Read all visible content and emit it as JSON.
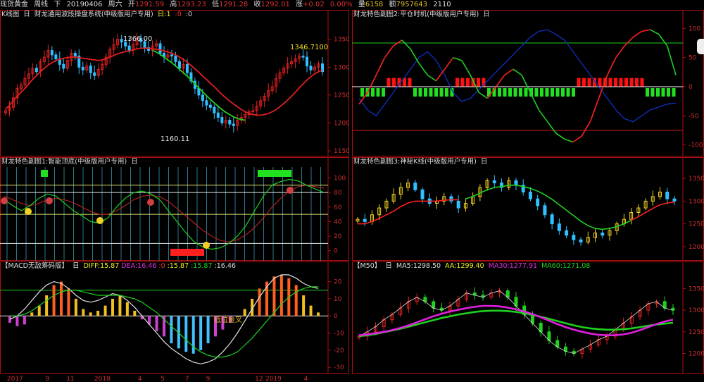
{
  "header": {
    "instrument": "现货黄金",
    "period": "周线",
    "direction": "下",
    "date": "20190406",
    "weekday": "周六",
    "open_label": "开",
    "open": "1291.59",
    "high_label": "高",
    "high": "1293.23",
    "low_label": "低",
    "low": "1291.28",
    "close_label": "收",
    "close": "1292.01",
    "change_label": "涨",
    "change": "+0.02",
    "change_pct": "0.00%",
    "volume_label": "量",
    "volume": "6158",
    "amount_label": "额",
    "amount": "7957643",
    "extra": "2110"
  },
  "panels": {
    "kline": {
      "title": "K线图",
      "box": "日",
      "subtitle": "财龙通用波段操盘系统(中级版用户专用)",
      "param1": "日:1",
      "param2": ":0",
      "param3": ":0",
      "ann_high": "1366.00",
      "ann_low": "1160.11",
      "ann_last": "1346.7100"
    },
    "sub2": {
      "title": "财龙特色副图2:平仓时机(中级版用户专用)",
      "box": "日"
    },
    "sub1": {
      "title": "财龙特色副图1:智能顶底(中级版用户专用)",
      "box": "日"
    },
    "sub3": {
      "title": "财龙特色副图3:神秘K线(中级版用户专用)",
      "box": "日"
    },
    "macd": {
      "title": "【MACD无敌筹码版】",
      "box": "日",
      "diff": "DIFF:15.87",
      "dea": "DEA:16.46",
      "v1": ":0",
      "v2": ":15.87",
      "v3": ":15.87",
      "v4": ":16.46",
      "ann": "低位金叉"
    },
    "ma": {
      "title": "【M50】",
      "box": "日",
      "ma5": "MA5:1298.50",
      "aa": "AA:1299.40",
      "ma30": "MA30:1277.91",
      "ma60": "MA60:1271.08"
    }
  },
  "x_axis_labels": [
    {
      "label": "2017",
      "at": 0.02
    },
    {
      "label": "9",
      "at": 0.13
    },
    {
      "label": "11",
      "at": 0.19
    },
    {
      "label": "2018",
      "at": 0.27
    },
    {
      "label": "4",
      "at": 0.395
    },
    {
      "label": "5",
      "at": 0.46
    },
    {
      "label": "7",
      "at": 0.53
    },
    {
      "label": "9",
      "at": 0.59
    },
    {
      "label": "12",
      "at": 0.73
    },
    {
      "label": "2019",
      "at": 0.76
    },
    {
      "label": "4",
      "at": 0.87
    }
  ],
  "chart_data": [
    {
      "type": "candlestick",
      "name": "K线图",
      "y_ticks": [
        1150,
        1200,
        1250,
        1300,
        1350
      ],
      "ylim": [
        1145,
        1385
      ],
      "close": [
        1222,
        1228,
        1245,
        1262,
        1268,
        1280,
        1288,
        1298,
        1292,
        1310,
        1318,
        1330,
        1322,
        1315,
        1305,
        1298,
        1312,
        1325,
        1320,
        1300,
        1295,
        1302,
        1290,
        1285,
        1296,
        1305,
        1318,
        1332,
        1340,
        1350,
        1345,
        1338,
        1330,
        1340,
        1352,
        1346,
        1335,
        1330,
        1338,
        1342,
        1325,
        1318,
        1322,
        1320,
        1310,
        1298,
        1305,
        1290,
        1275,
        1262,
        1250,
        1240,
        1232,
        1228,
        1218,
        1210,
        1200,
        1205,
        1198,
        1195,
        1205,
        1210,
        1215,
        1220,
        1222,
        1230,
        1240,
        1248,
        1258,
        1265,
        1280,
        1290,
        1298,
        1306,
        1310,
        1315,
        1320,
        1318,
        1302,
        1295,
        1300,
        1306,
        1292
      ],
      "ma_red": [
        1225,
        1232,
        1240,
        1248,
        1255,
        1262,
        1270,
        1278,
        1285,
        1292,
        1298,
        1304,
        1308,
        1312,
        1314,
        1316,
        1317,
        1318,
        1318,
        1317,
        1316,
        1315,
        1314,
        1313,
        1312,
        1313,
        1315,
        1318,
        1321,
        1324,
        1326,
        1328,
        1329,
        1331,
        1333,
        1334,
        1334,
        1334,
        1333,
        1332,
        1331,
        1329,
        1327,
        1325,
        1322,
        1318,
        1314,
        1309,
        1303,
        1297,
        1291,
        1284,
        1278,
        1271,
        1265,
        1258,
        1251,
        1245,
        1239,
        1234,
        1229,
        1224,
        1220,
        1217,
        1215,
        1214,
        1214,
        1215,
        1217,
        1220,
        1224,
        1229,
        1235,
        1241,
        1248,
        1255,
        1263,
        1270,
        1277,
        1283,
        1288,
        1292,
        1295
      ],
      "ma_green": [
        null,
        null,
        null,
        null,
        null,
        null,
        null,
        null,
        null,
        null,
        null,
        null,
        null,
        null,
        null,
        null,
        null,
        null,
        null,
        null,
        null,
        null,
        null,
        null,
        null,
        null,
        null,
        null,
        null,
        null,
        null,
        null,
        null,
        null,
        null,
        null,
        null,
        null,
        1330,
        1327,
        1323,
        1318,
        1313,
        1308,
        1302,
        1296,
        1290,
        1284,
        1277,
        1270,
        1263,
        1256,
        1249,
        1242,
        1236,
        1230,
        1224,
        1219,
        1215,
        1211,
        1208,
        1206,
        1205,
        null,
        null,
        null,
        null,
        null,
        null,
        null,
        null,
        null,
        null,
        null,
        null,
        null,
        null,
        null,
        null,
        null,
        null,
        null,
        null
      ]
    },
    {
      "type": "line",
      "name": "财龙特色副图2:平仓时机",
      "y_ticks": [
        -100,
        -50,
        0,
        50,
        100
      ],
      "ylim": [
        -115,
        115
      ],
      "series": [
        {
          "name": "up",
          "values": [
            -30,
            -10,
            20,
            50,
            70,
            80,
            65,
            40,
            20,
            10,
            30,
            50,
            45,
            20,
            -10,
            -20,
            0,
            20,
            30,
            20,
            -10,
            -40,
            -60,
            -80,
            -90,
            -95,
            -85,
            -60,
            -20,
            20,
            50,
            70,
            85,
            95,
            98,
            90,
            70,
            20
          ]
        },
        {
          "name": "down",
          "values": [
            -20,
            -40,
            -50,
            -30,
            -10,
            10,
            30,
            50,
            60,
            45,
            20,
            -10,
            -25,
            -20,
            -5,
            10,
            25,
            40,
            55,
            70,
            85,
            95,
            98,
            90,
            80,
            60,
            40,
            20,
            0,
            -20,
            -40,
            -55,
            -60,
            -50,
            -40,
            -35,
            -30,
            -28
          ]
        }
      ],
      "levels": [
        75,
        0,
        -75
      ]
    },
    {
      "type": "line",
      "name": "财龙特色副图1:智能顶底",
      "y_ticks": [
        0,
        20,
        40,
        60,
        80,
        100
      ],
      "ylim": [
        -10,
        115
      ],
      "series": [
        {
          "name": "fast",
          "values": [
            70,
            62,
            55,
            62,
            72,
            78,
            75,
            65,
            55,
            48,
            40,
            38,
            45,
            60,
            72,
            80,
            82,
            78,
            70,
            55,
            40,
            25,
            12,
            5,
            2,
            4,
            10,
            20,
            35,
            55,
            75,
            90,
            95,
            98,
            96,
            90,
            85,
            80
          ]
        },
        {
          "name": "slow",
          "values": [
            75,
            70,
            65,
            62,
            65,
            70,
            72,
            70,
            66,
            60,
            54,
            50,
            50,
            55,
            62,
            70,
            75,
            76,
            74,
            68,
            58,
            48,
            38,
            28,
            20,
            14,
            12,
            15,
            22,
            32,
            45,
            60,
            72,
            82,
            88,
            90,
            88,
            86
          ]
        }
      ],
      "levels": [
        90,
        80,
        50,
        10
      ]
    },
    {
      "type": "candlestick",
      "name": "财龙特色副图3:神秘K线",
      "y_ticks": [
        1200,
        1250,
        1300,
        1350
      ],
      "ylim": [
        1175,
        1375
      ],
      "close": [
        1260,
        1255,
        1270,
        1285,
        1300,
        1315,
        1330,
        1340,
        1325,
        1305,
        1295,
        1300,
        1310,
        1300,
        1285,
        1295,
        1310,
        1330,
        1345,
        1340,
        1330,
        1345,
        1335,
        1320,
        1305,
        1290,
        1270,
        1250,
        1235,
        1225,
        1215,
        1210,
        1220,
        1230,
        1225,
        1235,
        1250,
        1260,
        1275,
        1285,
        1300,
        1310,
        1320,
        1305,
        1300
      ],
      "line": [
        1250,
        1250,
        1255,
        1262,
        1270,
        1278,
        1288,
        1296,
        1300,
        1300,
        1300,
        1300,
        1302,
        1303,
        1303,
        1305,
        1310,
        1318,
        1325,
        1330,
        1332,
        1335,
        1335,
        1332,
        1328,
        1322,
        1314,
        1304,
        1292,
        1280,
        1268,
        1256,
        1246,
        1240,
        1238,
        1240,
        1244,
        1250,
        1258,
        1266,
        1275,
        1284,
        1292,
        1296,
        1298
      ]
    },
    {
      "type": "bar",
      "name": "MACD无敌筹码版",
      "y_ticks": [
        -30,
        -20,
        -10,
        0,
        10,
        20
      ],
      "ylim": [
        -32,
        26
      ],
      "values": [
        -4,
        -6,
        -5,
        2,
        6,
        12,
        18,
        20,
        16,
        10,
        4,
        2,
        3,
        6,
        10,
        12,
        8,
        3,
        -2,
        -5,
        -9,
        -12,
        -16,
        -19,
        -21,
        -22,
        -20,
        -16,
        -12,
        -8,
        -4,
        0,
        4,
        10,
        16,
        20,
        23,
        24,
        22,
        18,
        12,
        6,
        2
      ],
      "series": [
        {
          "name": "DIFF",
          "values": [
            -2,
            0,
            4,
            9,
            14,
            18,
            20,
            19,
            16,
            12,
            9,
            8,
            9,
            11,
            13,
            12,
            9,
            5,
            0,
            -5,
            -10,
            -15,
            -19,
            -22,
            -25,
            -27,
            -28,
            -27,
            -25,
            -21,
            -16,
            -10,
            -3,
            4,
            11,
            17,
            22,
            24,
            24,
            22,
            19,
            17,
            16
          ]
        },
        {
          "name": "DEA",
          "values": [
            0,
            0,
            1,
            3,
            6,
            9,
            12,
            14,
            15,
            15,
            14,
            13,
            12,
            12,
            12,
            12,
            11,
            10,
            8,
            5,
            2,
            -2,
            -6,
            -10,
            -14,
            -18,
            -21,
            -23,
            -24,
            -24,
            -23,
            -21,
            -17,
            -13,
            -8,
            -3,
            2,
            7,
            11,
            14,
            16,
            17,
            17
          ]
        }
      ]
    },
    {
      "type": "candlestick",
      "name": "M50",
      "y_ticks": [
        1200,
        1250,
        1300,
        1350
      ],
      "ylim": [
        1160,
        1390
      ],
      "close": [
        1240,
        1250,
        1262,
        1278,
        1290,
        1305,
        1320,
        1330,
        1320,
        1305,
        1300,
        1310,
        1325,
        1340,
        1335,
        1330,
        1340,
        1345,
        1330,
        1310,
        1290,
        1270,
        1250,
        1230,
        1215,
        1205,
        1200,
        1210,
        1220,
        1232,
        1240,
        1255,
        1270,
        1285,
        1300,
        1315,
        1320,
        1305,
        1300
      ],
      "series": [
        {
          "name": "MA30",
          "values": [
            1242,
            1244,
            1247,
            1250,
            1254,
            1259,
            1265,
            1272,
            1279,
            1286,
            1292,
            1297,
            1301,
            1305,
            1308,
            1310,
            1310,
            1309,
            1306,
            1302,
            1297,
            1291,
            1284,
            1276,
            1268,
            1261,
            1255,
            1250,
            1246,
            1243,
            1242,
            1242,
            1244,
            1248,
            1254,
            1261,
            1268,
            1274,
            1278
          ]
        },
        {
          "name": "MA60",
          "values": [
            1240,
            1242,
            1245,
            1249,
            1253,
            1257,
            1262,
            1267,
            1272,
            1277,
            1282,
            1286,
            1290,
            1293,
            1296,
            1298,
            1299,
            1299,
            1298,
            1296,
            1293,
            1289,
            1285,
            1280,
            1275,
            1270,
            1265,
            1261,
            1258,
            1256,
            1255,
            1255,
            1256,
            1258,
            1261,
            1264,
            1267,
            1269,
            1271
          ]
        }
      ]
    }
  ],
  "colors": {
    "up": "#e02020",
    "down": "#30c0ff",
    "axis": "#b01010",
    "green": "#20d020",
    "white": "#e0e0e0",
    "yellow": "#f0d020",
    "blue": "#1030c0",
    "magenta": "#e020e0"
  }
}
